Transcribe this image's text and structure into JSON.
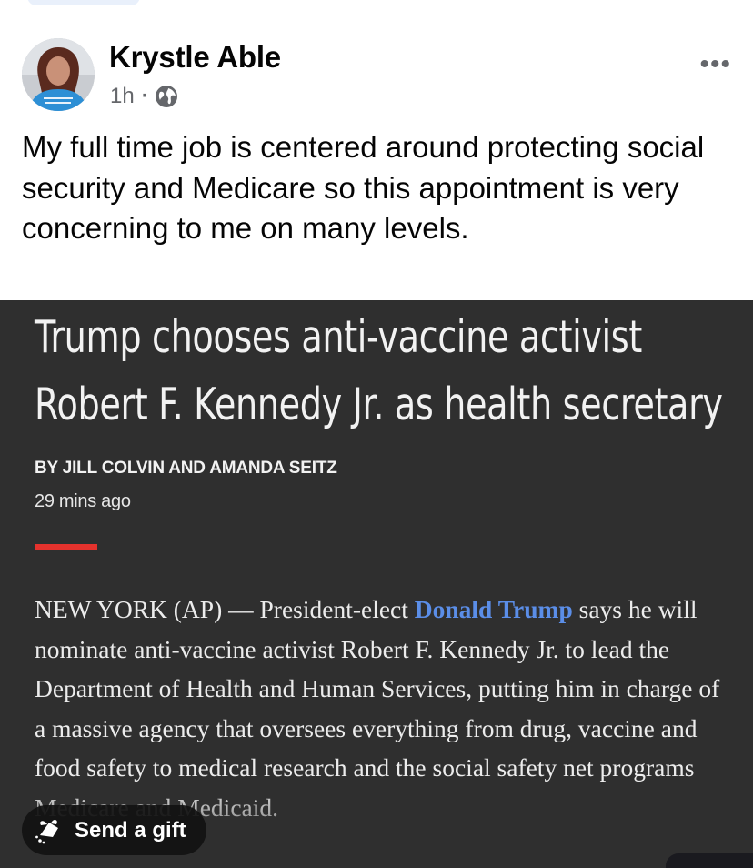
{
  "post": {
    "author": "Krystle Able",
    "time": "1h",
    "separator": "·",
    "more_icon": "more-horizontal-icon",
    "privacy_icon": "globe-icon",
    "text": "My full time job is centered around protecting social security and Medicare so this appointment is very concerning to me on many levels."
  },
  "article": {
    "headline_line1": "Trump chooses anti-vaccine activist",
    "headline_line2": "Robert F. Kennedy Jr. as health secretary",
    "byline": "BY JILL COLVIN AND AMANDA SEITZ",
    "timestamp": "29 mins ago",
    "body_part1": "NEW YORK (AP) — President-elect ",
    "body_link": "Donald Trump",
    "body_part2": " says he will nominate anti-vaccine activist Robert F. Kennedy Jr. to lead the Department of Health and Human Services, putting him in charge of a massive agency that oversees everything from drug, vaccine and food safety to medical research and the social safety net programs Medicare and Medicaid."
  },
  "gift_button": {
    "label": "Send a gift",
    "icon": "gift-icon"
  },
  "colors": {
    "article_background": "#2f2f2f",
    "link": "#5b8ee8",
    "accent_rule": "#e5322d"
  }
}
